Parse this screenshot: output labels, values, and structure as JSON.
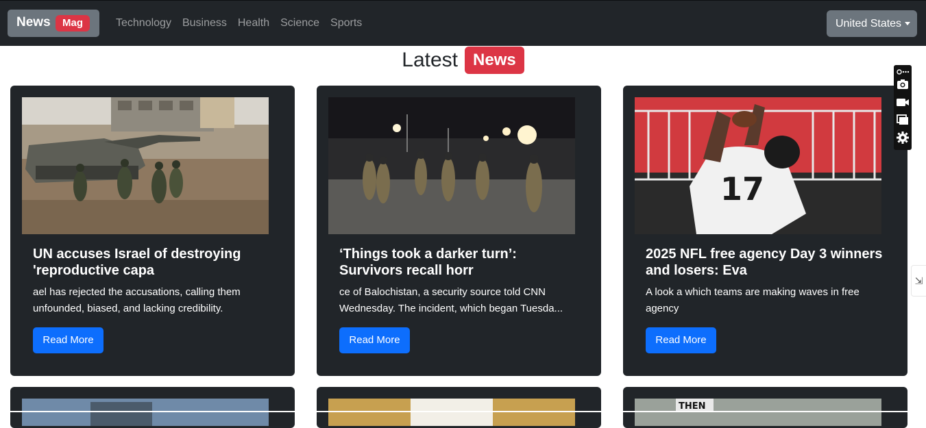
{
  "navbar": {
    "brand": "News",
    "brand_badge": "Mag",
    "links": [
      "Technology",
      "Business",
      "Health",
      "Science",
      "Sports"
    ],
    "country": "United States"
  },
  "headline": {
    "title": "Latest",
    "badge": "News"
  },
  "cards": [
    {
      "title": "UN accuses Israel of destroying 'reproductive capa",
      "description": "ael has rejected the accusations, calling them unfounded, biased, and lacking credibility.",
      "button": "Read More"
    },
    {
      "title": "‘Things took a darker turn’: Survivors recall horr",
      "description": "ce of Balochistan, a security source told CNN Wednesday. The incident, which began Tuesda...",
      "button": "Read More"
    },
    {
      "title": "2025 NFL free agency Day 3 winners and losers: Eva",
      "description": "A look a which teams are making waves in free agency",
      "button": "Read More"
    }
  ],
  "card_third_image_text": "THEN",
  "icons": [
    "camera-icon",
    "video-icon",
    "window-icon",
    "gear-icon",
    "link-icon",
    "more-icon"
  ],
  "colors": {
    "navbar": "#212529",
    "brand_bg": "#6c757d",
    "badge_red": "#dc3545",
    "button_blue": "#0d6efd"
  }
}
